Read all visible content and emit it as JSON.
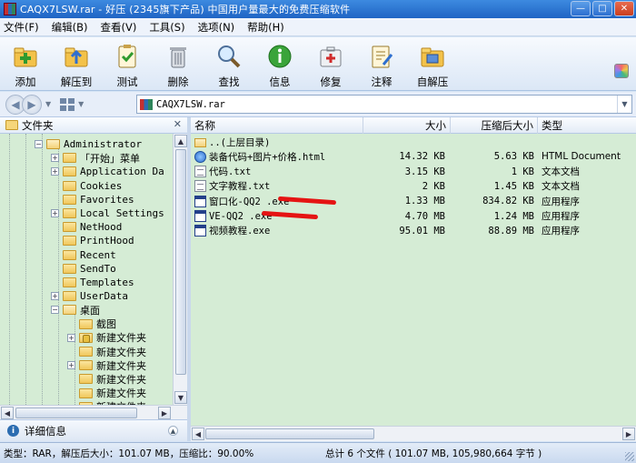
{
  "window": {
    "title": "CAQX7LSW.rar - 好压 (2345旗下产品) 中国用户量最大的免费压缩软件"
  },
  "menu": [
    "文件(F)",
    "编辑(B)",
    "查看(V)",
    "工具(S)",
    "选项(N)",
    "帮助(H)"
  ],
  "toolbar": [
    {
      "label": "添加",
      "icon": "add-archive-icon"
    },
    {
      "label": "解压到",
      "icon": "extract-folder-icon"
    },
    {
      "label": "测试",
      "icon": "test-clipboard-icon"
    },
    {
      "label": "删除",
      "icon": "trash-icon"
    },
    {
      "label": "查找",
      "icon": "magnifier-icon"
    },
    {
      "label": "信息",
      "icon": "info-icon"
    },
    {
      "label": "修复",
      "icon": "first-aid-icon"
    },
    {
      "label": "注释",
      "icon": "note-pencil-icon"
    },
    {
      "label": "自解压",
      "icon": "self-extract-icon"
    }
  ],
  "address": {
    "path": "CAQX7LSW.rar"
  },
  "tree": {
    "header": "文件夹",
    "items": [
      {
        "label": "Administrator",
        "expander": "-",
        "icon": "open"
      },
      {
        "label": "「开始」菜单",
        "expander": "+",
        "icon": "folder"
      },
      {
        "label": "Application Da",
        "expander": "+",
        "icon": "folder"
      },
      {
        "label": "Cookies",
        "expander": "",
        "icon": "folder"
      },
      {
        "label": "Favorites",
        "expander": "",
        "icon": "folder"
      },
      {
        "label": "Local Settings",
        "expander": "+",
        "icon": "folder"
      },
      {
        "label": "NetHood",
        "expander": "",
        "icon": "folder"
      },
      {
        "label": "PrintHood",
        "expander": "",
        "icon": "folder"
      },
      {
        "label": "Recent",
        "expander": "",
        "icon": "folder"
      },
      {
        "label": "SendTo",
        "expander": "",
        "icon": "folder"
      },
      {
        "label": "Templates",
        "expander": "",
        "icon": "folder"
      },
      {
        "label": "UserData",
        "expander": "+",
        "icon": "folder"
      },
      {
        "label": "桌面",
        "expander": "-",
        "icon": "open"
      },
      {
        "label": "截图",
        "expander": "",
        "icon": "folder"
      },
      {
        "label": "新建文件夹",
        "expander": "+",
        "icon": "lock"
      },
      {
        "label": "新建文件夹",
        "expander": "",
        "icon": "folder"
      },
      {
        "label": "新建文件夹",
        "expander": "+",
        "icon": "folder"
      },
      {
        "label": "新建文件夹",
        "expander": "",
        "icon": "folder"
      },
      {
        "label": "新建文件夹",
        "expander": "",
        "icon": "folder"
      },
      {
        "label": "新建文件夹",
        "expander": "",
        "icon": "folder"
      }
    ]
  },
  "detail": {
    "label": "详细信息"
  },
  "columns": {
    "name": "名称",
    "size": "大小",
    "packed": "压缩后大小",
    "type": "类型"
  },
  "files": [
    {
      "name": "..(上层目录)",
      "size": "",
      "packed": "",
      "type": "",
      "icon": "up"
    },
    {
      "name": "装备代码+图片+价格.html",
      "size": "14.32 KB",
      "packed": "5.63 KB",
      "type": "HTML Document",
      "icon": "html"
    },
    {
      "name": "代码.txt",
      "size": "3.15 KB",
      "packed": "1 KB",
      "type": "文本文档",
      "icon": "txt"
    },
    {
      "name": "文字教程.txt",
      "size": "2 KB",
      "packed": "1.45 KB",
      "type": "文本文档",
      "icon": "txt"
    },
    {
      "name": "窗口化-QQ2         .exe",
      "size": "1.33 MB",
      "packed": "834.82 KB",
      "type": "应用程序",
      "icon": "exe"
    },
    {
      "name": "VE-QQ2         .exe",
      "size": "4.70 MB",
      "packed": "1.24 MB",
      "type": "应用程序",
      "icon": "exe"
    },
    {
      "name": "视频教程.exe",
      "size": "95.01 MB",
      "packed": "88.89 MB",
      "type": "应用程序",
      "icon": "exe"
    }
  ],
  "status": {
    "left": "类型：RAR，解压后大小：101.07 MB，压缩比：90.00%",
    "right": "总计 6 个文件 ( 101.07 MB, 105,980,664 字节 )"
  },
  "colors": {
    "list_background": "#d5ecd5",
    "titlebar": "#1f64c4"
  }
}
